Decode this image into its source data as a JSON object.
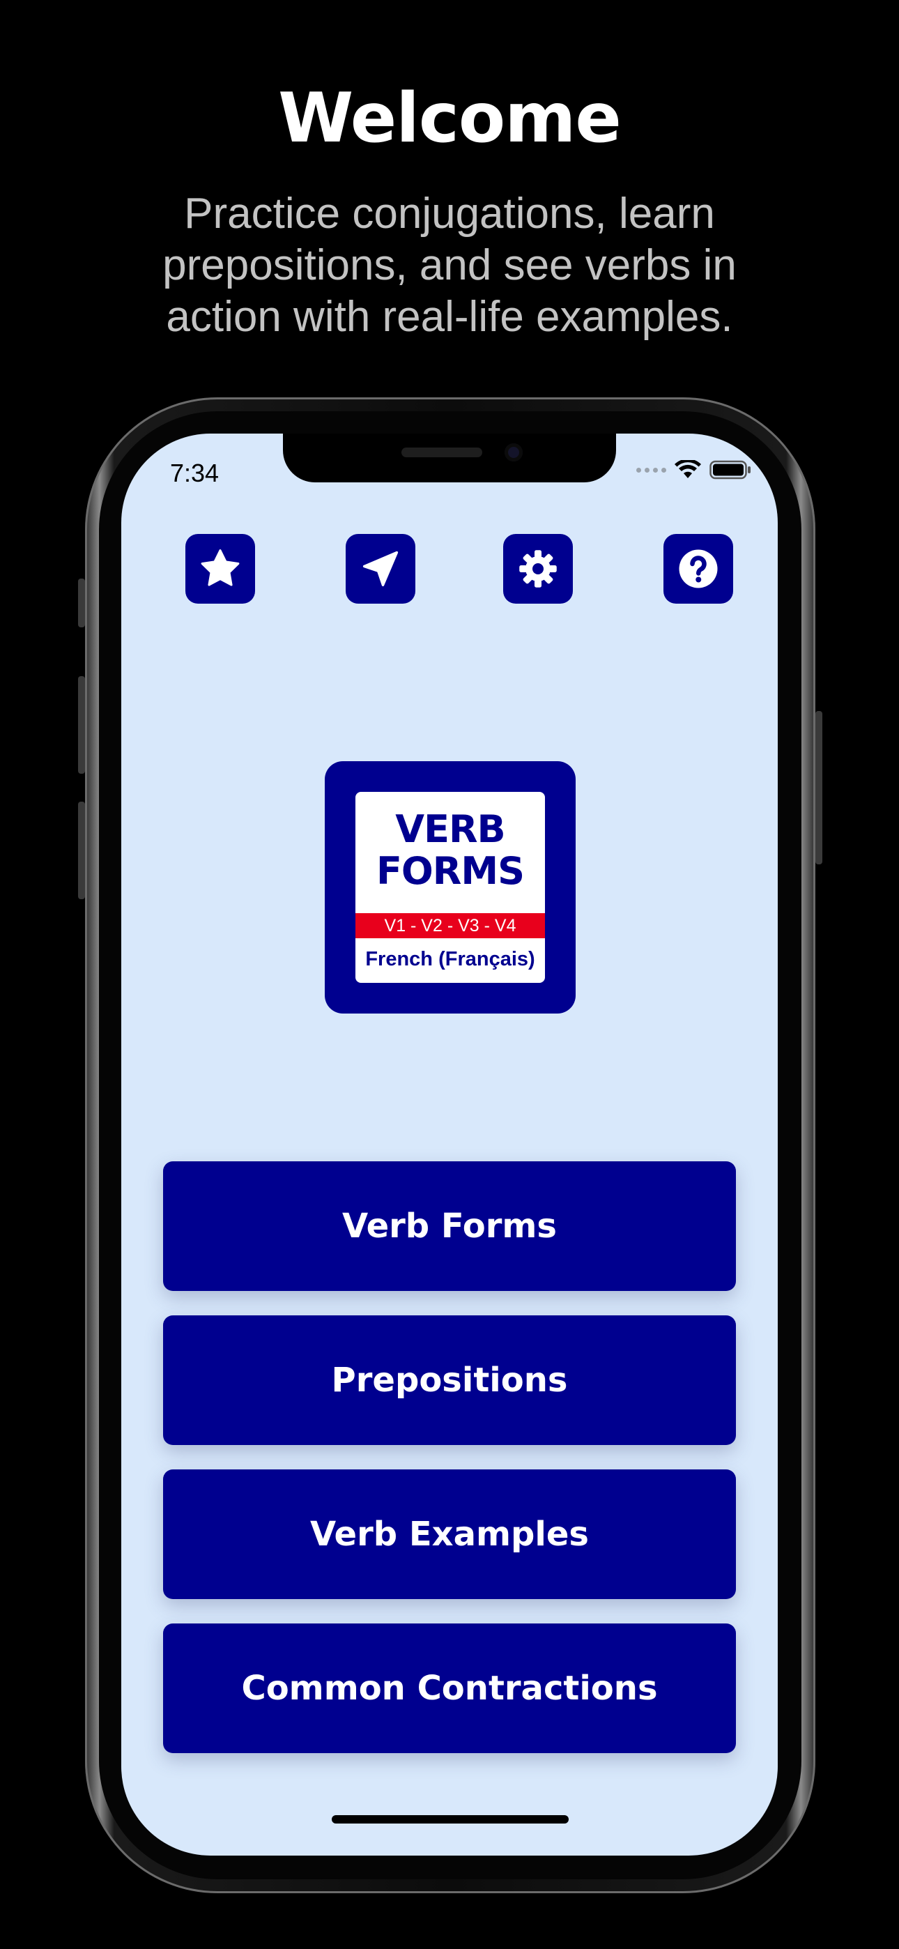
{
  "marketing": {
    "title": "Welcome",
    "subtitle": "Practice conjugations, learn prepositions, and see verbs in action with real-life examples."
  },
  "status_bar": {
    "time": "7:34",
    "icons": [
      "signal-dots-icon",
      "wifi-icon",
      "battery-icon"
    ]
  },
  "toolbar": {
    "icons": [
      "star-icon",
      "send-icon",
      "gear-icon",
      "help-icon"
    ]
  },
  "logo": {
    "title_line1": "VERB",
    "title_line2": "FORMS",
    "band": "V1 - V2 - V3 - V4",
    "language": "French (Français)"
  },
  "menu": {
    "items": [
      {
        "label": "Verb Forms"
      },
      {
        "label": "Prepositions"
      },
      {
        "label": "Verb Examples"
      },
      {
        "label": "Common Contractions"
      }
    ]
  },
  "colors": {
    "background": "#000000",
    "screen": "#d8e8fb",
    "primary": "#00008f",
    "accent_red": "#e8001c",
    "white": "#ffffff"
  }
}
